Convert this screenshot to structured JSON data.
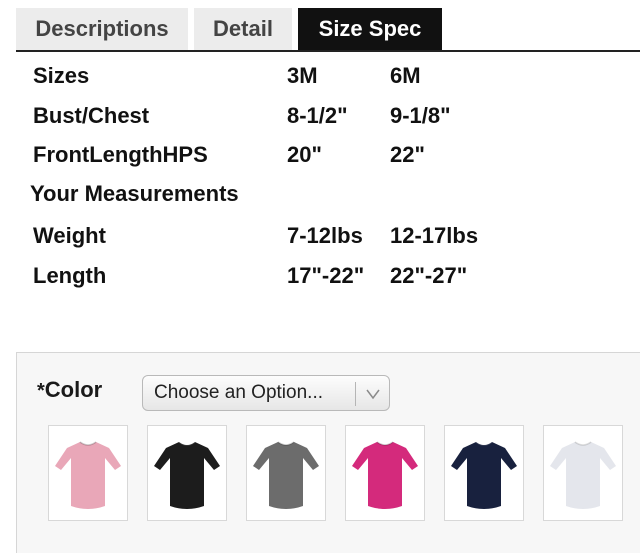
{
  "tabs": [
    {
      "label": "Descriptions"
    },
    {
      "label": "Detail"
    },
    {
      "label": "Size Spec",
      "active": true
    }
  ],
  "size_spec": {
    "rows": [
      {
        "label": "Sizes",
        "v1": "3M",
        "v2": "6M"
      },
      {
        "label": "Bust/Chest",
        "v1": "8-1/2\"",
        "v2": "9-1/8\""
      },
      {
        "label": "FrontLengthHPS",
        "v1": "20\"",
        "v2": "22\""
      },
      {
        "label": "Your Measurements",
        "section": true
      },
      {
        "label": "Weight",
        "v1": "7-12lbs",
        "v2": "12-17lbs"
      },
      {
        "label": "Length",
        "v1": "17\"-22\"",
        "v2": "22\"-27\""
      }
    ]
  },
  "options": {
    "required_mark": "*",
    "color_label": "Color",
    "select_value": "Choose an Option...",
    "swatches": [
      {
        "name": "pink",
        "color": "#e9a7b8",
        "icon": "baby-gown-icon"
      },
      {
        "name": "black",
        "color": "#1c1c1c",
        "icon": "baby-gown-icon"
      },
      {
        "name": "gray",
        "color": "#6c6c6c",
        "icon": "baby-gown-icon"
      },
      {
        "name": "fuchsia",
        "color": "#d42a7c",
        "icon": "baby-gown-icon"
      },
      {
        "name": "navy",
        "color": "#18213e",
        "icon": "baby-gown-icon"
      },
      {
        "name": "white",
        "color": "#e4e6ec",
        "icon": "baby-gown-icon"
      }
    ]
  }
}
